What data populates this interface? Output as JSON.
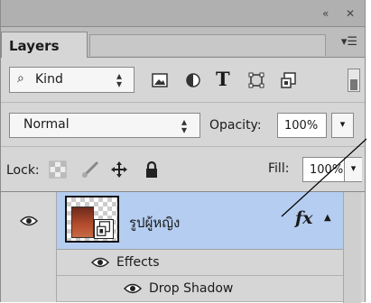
{
  "window": {
    "collapse_glyph": "«",
    "close_glyph": "✕"
  },
  "panel": {
    "tab_label": "Layers",
    "menu_glyph": "▾☰"
  },
  "filter": {
    "search_glyph": "⌕",
    "kind_label": "Kind",
    "spinner_up": "▴",
    "spinner_down": "▾",
    "icons": [
      "image-filter-icon",
      "adjustment-filter-icon",
      "type-filter-icon",
      "shape-filter-icon",
      "smart-object-filter-icon"
    ],
    "type_glyph": "T"
  },
  "blend": {
    "mode": "Normal",
    "opacity_label": "Opacity:",
    "opacity_value": "100%",
    "dropdown_glyph": "▾"
  },
  "lock": {
    "label": "Lock:",
    "icons": [
      "lock-transparent-pixels-icon",
      "lock-image-pixels-icon",
      "lock-position-icon",
      "lock-all-icon"
    ],
    "fill_label": "Fill:",
    "fill_value": "100%"
  },
  "layers": [
    {
      "name": "รูปผู้หญิง",
      "visible": true,
      "selected": true,
      "fx_label": "fx",
      "fx_arrow": "▲",
      "effects_label": "Effects",
      "effects": [
        "Drop Shadow"
      ]
    }
  ],
  "colors": {
    "selected_row": "#b4cdf0",
    "panel_bg": "#d6d6d6"
  }
}
